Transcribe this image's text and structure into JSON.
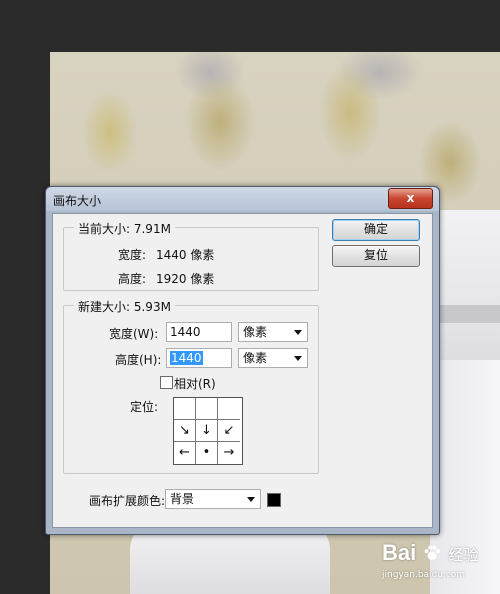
{
  "dialog": {
    "title": "画布大小",
    "close_label": "x",
    "current_size": {
      "legend": "当前大小: 7.91M",
      "width_label": "宽度:",
      "width_value": "1440 像素",
      "height_label": "高度:",
      "height_value": "1920 像素"
    },
    "new_size": {
      "legend": "新建大小: 5.93M",
      "width_label": "宽度(W):",
      "width_value": "1440",
      "width_unit": "像素",
      "height_label": "高度(H):",
      "height_value": "1440",
      "height_unit": "像素",
      "relative_label": "相对(R)",
      "relative_checked": false,
      "anchor_label": "定位:",
      "anchor_cells": [
        "",
        "",
        "",
        "↘",
        "↓",
        "↙",
        "←",
        "•",
        "→"
      ]
    },
    "extension_color_label": "画布扩展颜色:",
    "extension_color_value": "背景",
    "extension_color_swatch": "#000000",
    "ok_label": "确定",
    "reset_label": "复位"
  },
  "watermark": {
    "logo_text_left": "Bai",
    "logo_text_right": "经验",
    "url": "jingyan.baidu.com"
  }
}
